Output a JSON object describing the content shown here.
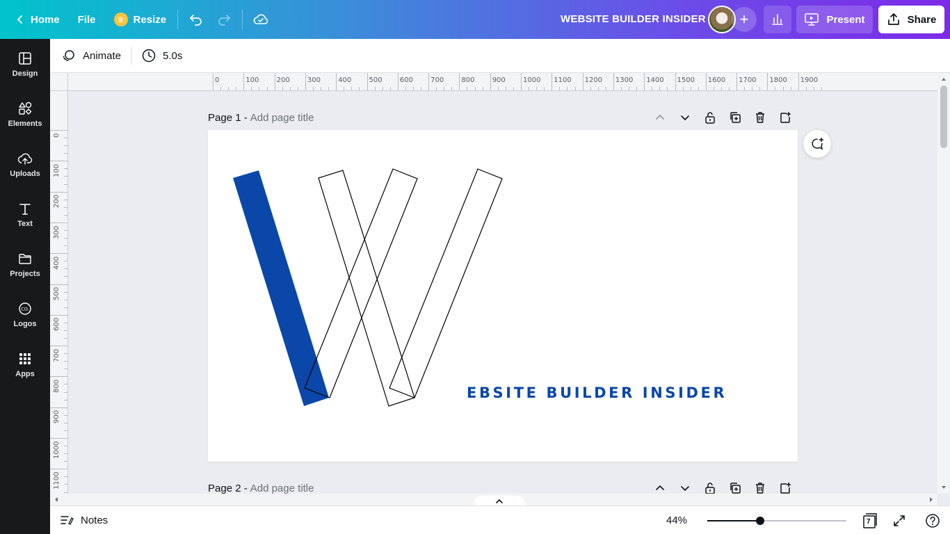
{
  "topbar": {
    "home_label": "Home",
    "file_label": "File",
    "resize_label": "Resize",
    "doc_title": "WEBSITE BUILDER INSIDER",
    "present_label": "Present",
    "share_label": "Share",
    "gradient_start": "#00c4cc",
    "gradient_end": "#7d2ae8"
  },
  "sidebar": {
    "items": [
      {
        "label": "Design",
        "icon": "layout-icon"
      },
      {
        "label": "Elements",
        "icon": "shapes-icon"
      },
      {
        "label": "Uploads",
        "icon": "cloud-upload-icon"
      },
      {
        "label": "Text",
        "icon": "text-icon"
      },
      {
        "label": "Projects",
        "icon": "folder-icon"
      },
      {
        "label": "Logos",
        "icon": "brand-logo-icon"
      },
      {
        "label": "Apps",
        "icon": "apps-grid-icon"
      }
    ]
  },
  "context_toolbar": {
    "animate_label": "Animate",
    "duration_label": "5.0s"
  },
  "rulers": {
    "horizontal": [
      "0",
      "100",
      "200",
      "300",
      "400",
      "500",
      "600",
      "700",
      "800",
      "900",
      "1000",
      "1100",
      "1200",
      "1300",
      "1400",
      "1500",
      "1600",
      "1700",
      "1800",
      "1900"
    ],
    "vertical": [
      "0",
      "100",
      "200",
      "300",
      "400",
      "500",
      "600",
      "700",
      "800",
      "900",
      "1000",
      "1100"
    ]
  },
  "pages": [
    {
      "name": "Page 1 -",
      "title_placeholder": "Add page title"
    },
    {
      "name": "Page 2 -",
      "title_placeholder": "Add page title"
    }
  ],
  "canvas": {
    "logo_text": "EBSITE BUILDER INSIDER",
    "brand_color": "#0a47a9"
  },
  "bottombar": {
    "notes_label": "Notes",
    "zoom_label": "44%",
    "zoom_fraction": 0.38,
    "page_count": "7"
  }
}
